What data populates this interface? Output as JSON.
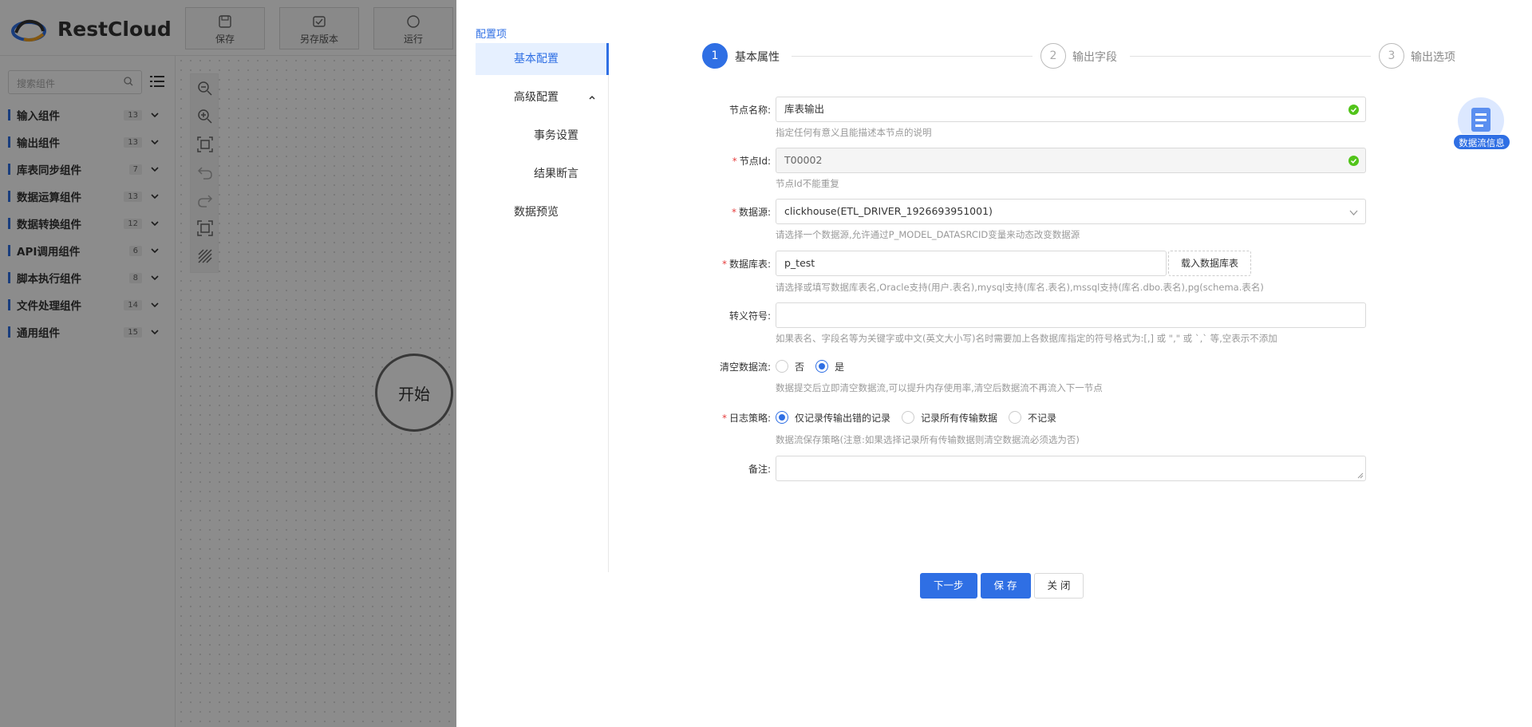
{
  "app": {
    "logo_text": "RestCloud",
    "toolbar": [
      {
        "label": "保存",
        "icon": "save-icon"
      },
      {
        "label": "另存版本",
        "icon": "save-version-icon"
      },
      {
        "label": "运行",
        "icon": "run-icon"
      }
    ],
    "search_placeholder": "搜索组件",
    "categories": [
      {
        "name": "输入组件",
        "count": "13"
      },
      {
        "name": "输出组件",
        "count": "13"
      },
      {
        "name": "库表同步组件",
        "count": "7"
      },
      {
        "name": "数据运算组件",
        "count": "13"
      },
      {
        "name": "数据转换组件",
        "count": "12"
      },
      {
        "name": "API调用组件",
        "count": "6"
      },
      {
        "name": "脚本执行组件",
        "count": "8"
      },
      {
        "name": "文件处理组件",
        "count": "14"
      },
      {
        "name": "通用组件",
        "count": "15"
      }
    ],
    "start_node": "开始"
  },
  "drawer": {
    "config_title": "配置项",
    "menu": {
      "basic": "基本配置",
      "advanced": "高级配置",
      "transaction": "事务设置",
      "assertion": "结果断言",
      "preview": "数据预览"
    },
    "steps": [
      {
        "num": "1",
        "label": "基本属性",
        "state": "active"
      },
      {
        "num": "2",
        "label": "输出字段",
        "state": "inactive"
      },
      {
        "num": "3",
        "label": "输出选项",
        "state": "inactive"
      }
    ],
    "flow_info_label": "数据流信息",
    "form": {
      "node_name": {
        "label": "节点名称:",
        "value": "库表输出",
        "help": "指定任何有意义且能描述本节点的说明"
      },
      "node_id": {
        "label": "节点Id:",
        "value": "T00002",
        "help": "节点Id不能重复"
      },
      "datasource": {
        "label": "数据源:",
        "value": "clickhouse(ETL_DRIVER_1926693951001)",
        "help": "请选择一个数据源,允许通过P_MODEL_DATASRCID变量来动态改变数据源"
      },
      "table": {
        "label": "数据库表:",
        "value": "p_test",
        "button": "载入数据库表",
        "help": "请选择或填写数据库表名,Oracle支持(用户.表名),mysql支持(库名.表名),mssql支持(库名.dbo.表名),pg(schema.表名)"
      },
      "escape": {
        "label": "转义符号:",
        "value": "",
        "help": "如果表名、字段名等为关键字或中文(英文大小写)名时需要加上各数据库指定的符号格式为:[,] 或 \",\" 或 `,` 等,空表示不添加"
      },
      "clear_stream": {
        "label": "清空数据流:",
        "options": [
          "否",
          "是"
        ],
        "selected": "是",
        "help": "数据提交后立即清空数据流,可以提升内存使用率,清空后数据流不再流入下一节点"
      },
      "log_policy": {
        "label": "日志策略:",
        "options": [
          "仅记录传输出错的记录",
          "记录所有传输数据",
          "不记录"
        ],
        "selected": "仅记录传输出错的记录",
        "help": "数据流保存策略(注意:如果选择记录所有传输数据则清空数据流必须选为否)"
      },
      "remark": {
        "label": "备注:",
        "value": ""
      }
    },
    "buttons": {
      "next": "下一步",
      "save": "保 存",
      "close": "关 闭"
    }
  },
  "colors": {
    "primary": "#2f6fe4",
    "required": "#e64040",
    "success": "#52c41a"
  }
}
